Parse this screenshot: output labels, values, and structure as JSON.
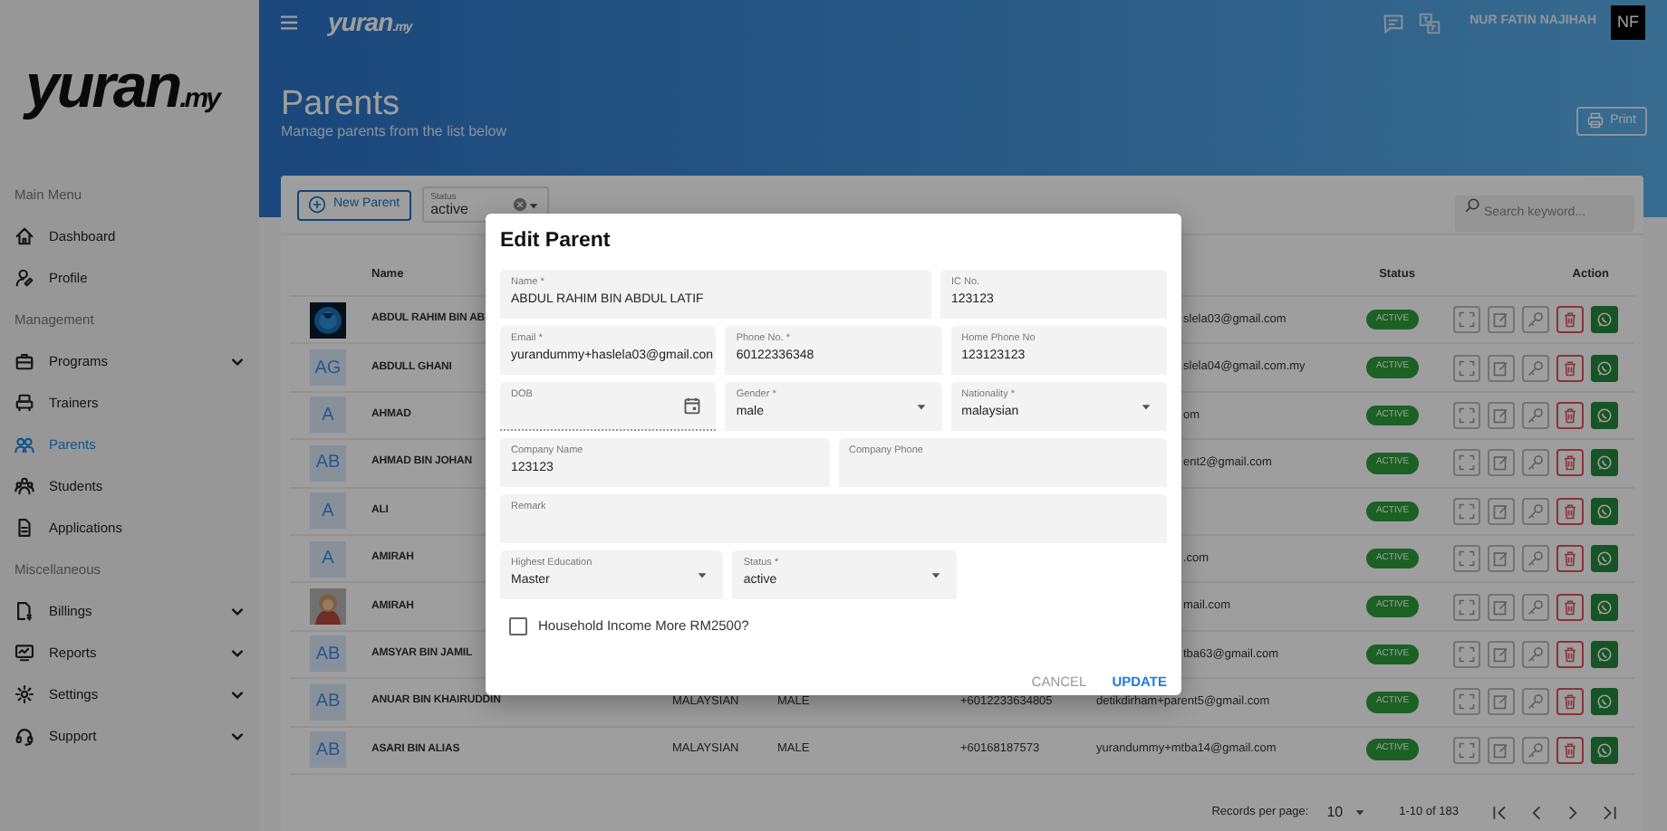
{
  "sidebar": {
    "logo": {
      "main": "yuran",
      "suffix": ".my"
    },
    "sections": [
      {
        "title": "Main Menu",
        "items": [
          {
            "label": "Dashboard",
            "selected": false,
            "has_submenu": false
          },
          {
            "label": "Profile",
            "selected": false,
            "has_submenu": false
          }
        ]
      },
      {
        "title": "Management",
        "items": [
          {
            "label": "Programs",
            "selected": false,
            "has_submenu": true
          },
          {
            "label": "Trainers",
            "selected": false,
            "has_submenu": false
          },
          {
            "label": "Parents",
            "selected": true,
            "has_submenu": false
          },
          {
            "label": "Students",
            "selected": false,
            "has_submenu": false
          },
          {
            "label": "Applications",
            "selected": false,
            "has_submenu": false
          }
        ]
      },
      {
        "title": "Miscellaneous",
        "items": [
          {
            "label": "Billings",
            "selected": false,
            "has_submenu": true
          },
          {
            "label": "Reports",
            "selected": false,
            "has_submenu": true
          },
          {
            "label": "Settings",
            "selected": false,
            "has_submenu": true
          },
          {
            "label": "Support",
            "selected": false,
            "has_submenu": true
          }
        ]
      }
    ]
  },
  "header": {
    "logo": {
      "main": "yuran",
      "suffix": ".my"
    },
    "user_name": "NUR FATIN NAJIHAH",
    "user_initials": "NF"
  },
  "page": {
    "title": "Parents",
    "subtitle": "Manage parents from the list below",
    "print_button": "Print"
  },
  "toolbar": {
    "new_button": "New Parent",
    "status_filter": {
      "label": "Status",
      "value": "active"
    },
    "search": {
      "placeholder": "Search keyword..."
    }
  },
  "table": {
    "columns": [
      {
        "label": "Name"
      },
      {
        "label": "Status"
      },
      {
        "label": "Action"
      }
    ],
    "rows": [
      {
        "name": "ABDUL RAHIM BIN AB",
        "email": "slela03@gmail.com",
        "status": "ACTIVE"
      },
      {
        "avatar": {
          "kind": "initials",
          "initials": "AG"
        },
        "name": "ABDULL GHANI",
        "email": "slela04@gmail.com.my",
        "status": "ACTIVE"
      },
      {
        "avatar": {
          "kind": "initials",
          "initials": "A"
        },
        "name": "AHMAD",
        "email": "om",
        "status": "ACTIVE"
      },
      {
        "avatar": {
          "kind": "initials",
          "initials": "AB"
        },
        "name": "AHMAD BIN JOHAN",
        "email": "ent2@gmail.com",
        "status": "ACTIVE"
      },
      {
        "avatar": {
          "kind": "initials",
          "initials": "A"
        },
        "name": "ALI",
        "status": "ACTIVE"
      },
      {
        "avatar": {
          "kind": "initials",
          "initials": "A"
        },
        "name": "AMIRAH",
        "email": ".com",
        "status": "ACTIVE"
      },
      {
        "name": "AMIRAH",
        "email": "mail.com",
        "status": "ACTIVE"
      },
      {
        "avatar": {
          "kind": "initials",
          "initials": "AB"
        },
        "name": "AMSYAR BIN JAMIL",
        "email": "tba63@gmail.com",
        "status": "ACTIVE"
      },
      {
        "avatar": {
          "kind": "initials",
          "initials": "AB"
        },
        "name": "ANUAR BIN KHAIRUDDIN",
        "nationality": "MALAYSIAN",
        "gender": "MALE",
        "phone": "+6012233634805",
        "email": "detikdirham+parent5@gmail.com",
        "status": "ACTIVE"
      },
      {
        "avatar": {
          "kind": "initials",
          "initials": "AB"
        },
        "name": "ASARI BIN ALIAS",
        "nationality": "MALAYSIAN",
        "gender": "MALE",
        "phone": "+60168187573",
        "email": "yurandummy+mtba14@gmail.com",
        "status": "ACTIVE"
      }
    ]
  },
  "pagination": {
    "records_label": "Records per page:",
    "per_page": "10",
    "range": "1-10 of 183"
  },
  "modal": {
    "title": "Edit Parent",
    "form_rows": [
      [
        {
          "label": "Name *",
          "value": "ABDUL RAHIM BIN ABDUL LATIF",
          "kind": "text"
        },
        {
          "label": "IC No.",
          "value": "123123",
          "kind": "text"
        }
      ],
      [
        {
          "label": "Email *",
          "value": "yurandummy+haslela03@gmail.con",
          "kind": "text"
        },
        {
          "label": "Phone No. *",
          "value": "60122336348",
          "kind": "text"
        },
        {
          "label": "Home Phone No",
          "value": "123123123",
          "kind": "text"
        }
      ],
      [
        {
          "label": "DOB",
          "kind": "date"
        },
        {
          "label": "Gender *",
          "value": "male",
          "kind": "select"
        },
        {
          "label": "Nationality *",
          "value": "malaysian",
          "kind": "select"
        }
      ],
      [
        {
          "label": "Company Name",
          "value": "123123",
          "kind": "text"
        },
        {
          "label": "Company Phone",
          "kind": "text"
        }
      ],
      [
        {
          "label": "Remark",
          "kind": "text"
        }
      ],
      [
        {
          "label": "Highest Education",
          "value": "Master",
          "kind": "select"
        },
        {
          "label": "Status *",
          "value": "active",
          "kind": "select"
        }
      ]
    ],
    "checkbox": {
      "label": "Household Income More RM2500?",
      "checked": false
    },
    "buttons": [
      {
        "label": "CANCEL",
        "kind": "secondary"
      },
      {
        "label": "UPDATE",
        "kind": "primary"
      }
    ]
  }
}
